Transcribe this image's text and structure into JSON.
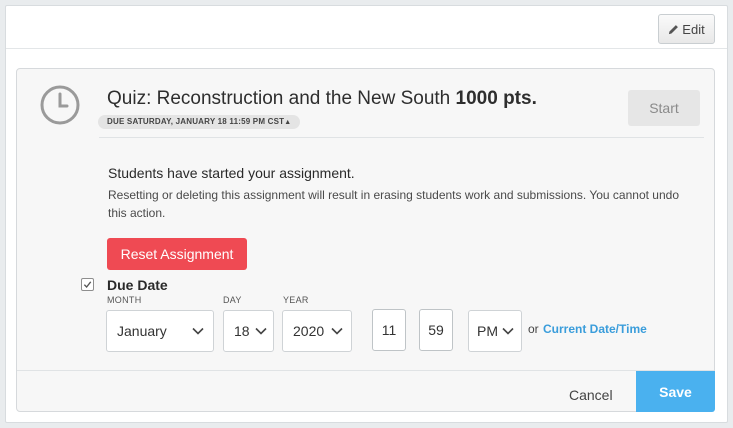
{
  "header": {
    "edit_label": "Edit"
  },
  "assignment": {
    "title": "Quiz: Reconstruction and the New South",
    "points": "1000 pts.",
    "due_pill": "DUE SATURDAY, JANUARY 18 11:59 PM CST",
    "start_label": "Start"
  },
  "notice": {
    "heading": "Students have started your assignment.",
    "body": "Resetting or deleting this assignment will result in erasing students work and submissions. You cannot undo this action.",
    "reset_label": "Reset Assignment"
  },
  "due_date": {
    "checked": true,
    "label": "Due Date",
    "month_label": "MONTH",
    "day_label": "DAY",
    "year_label": "YEAR",
    "month": "January",
    "day": "18",
    "year": "2020",
    "hour": "11",
    "minute": "59",
    "colon": ":",
    "ampm": "PM",
    "or_text": "or",
    "current_link": "Current Date/Time"
  },
  "footer": {
    "cancel_label": "Cancel",
    "save_label": "Save"
  },
  "colors": {
    "save": "#4ab1ef",
    "reset": "#ef4a53",
    "link": "#3a9ddb"
  }
}
